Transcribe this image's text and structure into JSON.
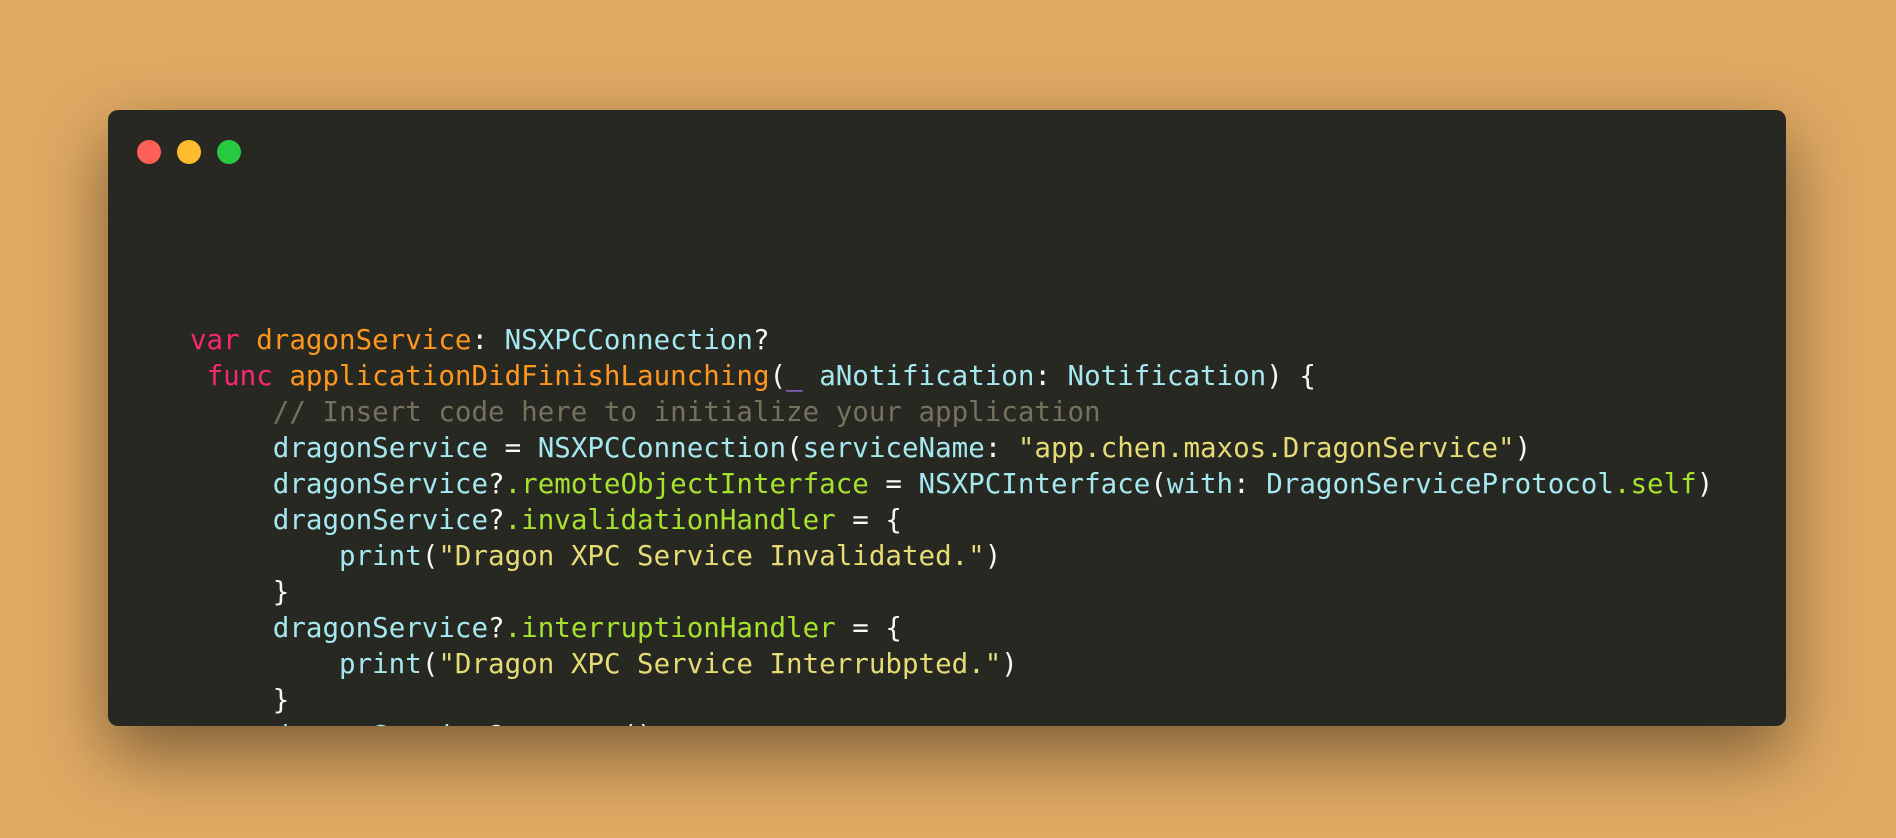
{
  "window": {
    "controls": [
      "close",
      "minimize",
      "zoom"
    ]
  },
  "colors": {
    "background": "#dfa963",
    "editor_background": "#272822",
    "close": "#ff5f56",
    "minimize": "#ffbd2e",
    "zoom": "#27c93f",
    "keyword": "#f92672",
    "identifier": "#a6e8f0",
    "declaration": "#fd971f",
    "member": "#a6e22e",
    "string": "#e6db74",
    "comment": "#75715e",
    "default": "#f8f8f2",
    "punct_accent": "#ae81ff"
  },
  "code": {
    "lines": [
      {
        "indent": "",
        "tokens": [
          {
            "t": "var",
            "c": "keyword"
          },
          {
            "t": " ",
            "c": "default"
          },
          {
            "t": "dragonService",
            "c": "declaration"
          },
          {
            "t": ": ",
            "c": "default"
          },
          {
            "t": "NSXPCConnection",
            "c": "identifier"
          },
          {
            "t": "?",
            "c": "default"
          }
        ]
      },
      {
        "indent": " ",
        "tokens": [
          {
            "t": "func",
            "c": "keyword"
          },
          {
            "t": " ",
            "c": "default"
          },
          {
            "t": "applicationDidFinishLaunching",
            "c": "declaration"
          },
          {
            "t": "(",
            "c": "default"
          },
          {
            "t": "_",
            "c": "punct_accent"
          },
          {
            "t": " ",
            "c": "default"
          },
          {
            "t": "aNotification",
            "c": "identifier"
          },
          {
            "t": ": ",
            "c": "default"
          },
          {
            "t": "Notification",
            "c": "identifier"
          },
          {
            "t": ") {",
            "c": "default"
          }
        ]
      },
      {
        "indent": "     ",
        "tokens": [
          {
            "t": "// Insert code here to initialize your application",
            "c": "comment"
          }
        ]
      },
      {
        "indent": "     ",
        "tokens": [
          {
            "t": "dragonService",
            "c": "identifier"
          },
          {
            "t": " = ",
            "c": "default"
          },
          {
            "t": "NSXPCConnection",
            "c": "identifier"
          },
          {
            "t": "(",
            "c": "default"
          },
          {
            "t": "serviceName",
            "c": "identifier"
          },
          {
            "t": ": ",
            "c": "default"
          },
          {
            "t": "\"app.chen.maxos.DragonService\"",
            "c": "string"
          },
          {
            "t": ")",
            "c": "default"
          }
        ]
      },
      {
        "indent": "     ",
        "tokens": [
          {
            "t": "dragonService",
            "c": "identifier"
          },
          {
            "t": "?",
            "c": "default"
          },
          {
            "t": ".remoteObjectInterface",
            "c": "member"
          },
          {
            "t": " = ",
            "c": "default"
          },
          {
            "t": "NSXPCInterface",
            "c": "identifier"
          },
          {
            "t": "(",
            "c": "default"
          },
          {
            "t": "with",
            "c": "identifier"
          },
          {
            "t": ": ",
            "c": "default"
          },
          {
            "t": "DragonServiceProtocol",
            "c": "identifier"
          },
          {
            "t": ".self",
            "c": "member"
          },
          {
            "t": ")",
            "c": "default"
          }
        ]
      },
      {
        "indent": "     ",
        "tokens": [
          {
            "t": "dragonService",
            "c": "identifier"
          },
          {
            "t": "?",
            "c": "default"
          },
          {
            "t": ".invalidationHandler",
            "c": "member"
          },
          {
            "t": " = {",
            "c": "default"
          }
        ]
      },
      {
        "indent": "         ",
        "tokens": [
          {
            "t": "print",
            "c": "identifier"
          },
          {
            "t": "(",
            "c": "default"
          },
          {
            "t": "\"Dragon XPC Service Invalidated.\"",
            "c": "string"
          },
          {
            "t": ")",
            "c": "default"
          }
        ]
      },
      {
        "indent": "     ",
        "tokens": [
          {
            "t": "}",
            "c": "default"
          }
        ]
      },
      {
        "indent": "     ",
        "tokens": [
          {
            "t": "dragonService",
            "c": "identifier"
          },
          {
            "t": "?",
            "c": "default"
          },
          {
            "t": ".interruptionHandler",
            "c": "member"
          },
          {
            "t": " = {",
            "c": "default"
          }
        ]
      },
      {
        "indent": "         ",
        "tokens": [
          {
            "t": "print",
            "c": "identifier"
          },
          {
            "t": "(",
            "c": "default"
          },
          {
            "t": "\"Dragon XPC Service Interrubpted.\"",
            "c": "string"
          },
          {
            "t": ")",
            "c": "default"
          }
        ]
      },
      {
        "indent": "     ",
        "tokens": [
          {
            "t": "}",
            "c": "default"
          }
        ]
      },
      {
        "indent": "     ",
        "tokens": [
          {
            "t": "dragonService",
            "c": "identifier"
          },
          {
            "t": "?",
            "c": "default"
          },
          {
            "t": ".resume",
            "c": "member"
          },
          {
            "t": "()",
            "c": "default"
          }
        ]
      },
      {
        "indent": " ",
        "tokens": [
          {
            "t": "}",
            "c": "default"
          }
        ]
      }
    ]
  }
}
